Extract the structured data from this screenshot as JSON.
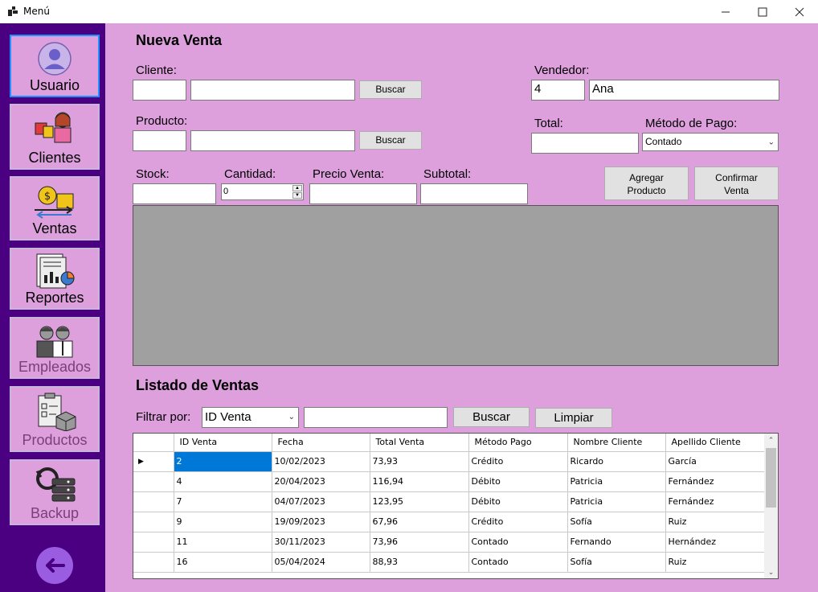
{
  "window": {
    "title": "Menú"
  },
  "sidebar": {
    "items": [
      {
        "label": "Usuario"
      },
      {
        "label": "Clientes"
      },
      {
        "label": "Ventas"
      },
      {
        "label": "Reportes"
      },
      {
        "label": "Empleados"
      },
      {
        "label": "Productos"
      },
      {
        "label": "Backup"
      }
    ]
  },
  "nueva_venta": {
    "title": "Nueva Venta",
    "cliente_label": "Cliente:",
    "cliente_id": "",
    "cliente_nombre": "",
    "buscar_cliente": "Buscar",
    "producto_label": "Producto:",
    "producto_id": "",
    "producto_nombre": "",
    "buscar_producto": "Buscar",
    "vendedor_label": "Vendedor:",
    "vendedor_id": "4",
    "vendedor_nombre": "Ana",
    "total_label": "Total:",
    "total_value": "",
    "metodo_label": "Método de Pago:",
    "metodo_value": "Contado",
    "stock_label": "Stock:",
    "stock_value": "",
    "cantidad_label": "Cantidad:",
    "cantidad_value": "0",
    "precio_label": "Precio Venta:",
    "precio_value": "",
    "subtotal_label": "Subtotal:",
    "subtotal_value": "",
    "agregar_line1": "Agregar",
    "agregar_line2": "Producto",
    "confirmar_line1": "Confirmar",
    "confirmar_line2": "Venta"
  },
  "listado": {
    "title": "Listado de Ventas",
    "filtrar_label": "Filtrar por:",
    "filtro_value": "ID Venta",
    "search_value": "",
    "buscar": "Buscar",
    "limpiar": "Limpiar",
    "columns": [
      "ID Venta",
      "Fecha",
      "Total Venta",
      "Método Pago",
      "Nombre Cliente",
      "Apellido Cliente"
    ],
    "rows": [
      [
        "2",
        "10/02/2023",
        "73,93",
        "Crédito",
        "Ricardo",
        "García"
      ],
      [
        "4",
        "20/04/2023",
        "116,94",
        "Débito",
        "Patricia",
        "Fernández"
      ],
      [
        "7",
        "04/07/2023",
        "123,95",
        "Débito",
        "Patricia",
        "Fernández"
      ],
      [
        "9",
        "19/09/2023",
        "67,96",
        "Crédito",
        "Sofía",
        "Ruiz"
      ],
      [
        "11",
        "30/11/2023",
        "73,96",
        "Contado",
        "Fernando",
        "Hernández"
      ],
      [
        "16",
        "05/04/2024",
        "88,93",
        "Contado",
        "Sofía",
        "Ruiz"
      ]
    ]
  }
}
